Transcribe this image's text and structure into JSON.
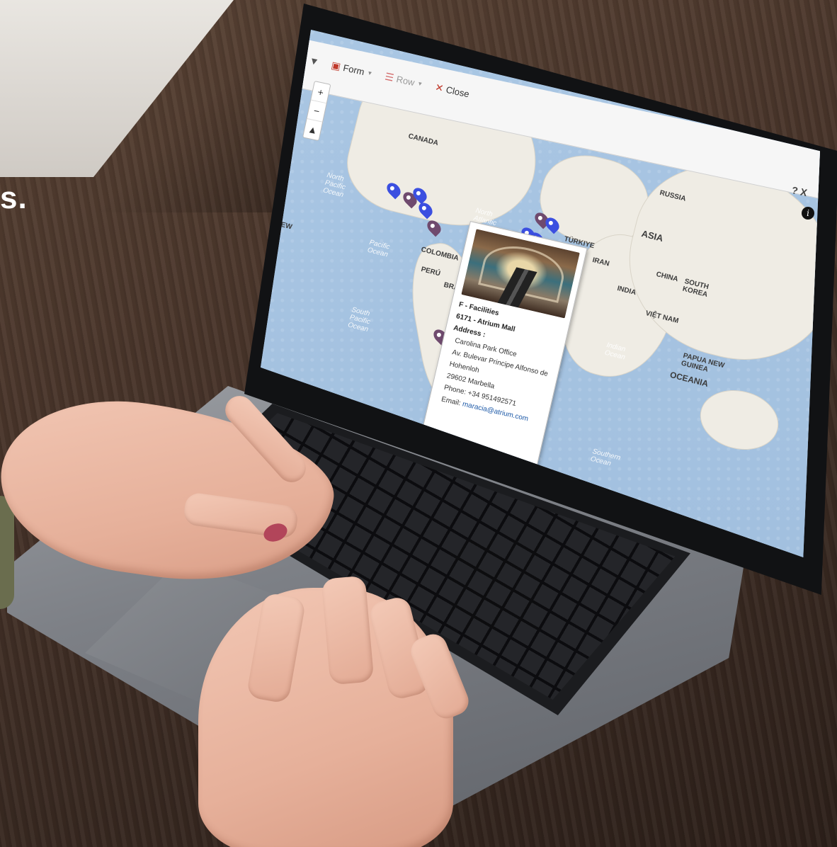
{
  "edge_text": "s.",
  "toolbar": {
    "form_label": "Form",
    "row_label": "Row",
    "close_label": "Close",
    "dropdown_caret": "▼"
  },
  "zoom": {
    "in": "+",
    "out": "−"
  },
  "window_controls": {
    "help": "?",
    "close": "X"
  },
  "map_labels": {
    "canada": "CANADA",
    "russia": "RUSSIA",
    "asia": "ASIA",
    "turkiye": "TÜRKIYE",
    "iran": "IRAN",
    "colombia": "COLOMBIA",
    "peru": "PERÚ",
    "bra": "BRA",
    "india": "INDIA",
    "china": "CHINA",
    "south_korea": "SOUTH KOREA",
    "viet_nam": "VIỆT NAM",
    "png": "PAPUA NEW GUINEA",
    "oceania": "OCEANIA",
    "ew": "EW"
  },
  "ocean_labels": {
    "north_atlantic": "North Atlantic",
    "pacific": "Pacific Ocean",
    "south_pacific": "South Pacific Ocean",
    "north_pacific": "North Pacific Ocean",
    "indian": "Indian Ocean",
    "southern": "Southern Ocean"
  },
  "popup": {
    "category": "F - Facilities",
    "title": "6171 - Atrium Mall",
    "address_label": "Address :",
    "address_line1": "Carolina Park Office",
    "address_line2": "Av. Bulevar Principe Alfonso de",
    "address_line3": "Hohenloh",
    "address_line4": "29602 Marbella",
    "phone": "Phone: +34 951492571",
    "email_label": "Email:",
    "email": "maracia@atrium.com"
  },
  "colors": {
    "pin_blue": "#3b4fe0",
    "pin_purple": "#6f4a6e",
    "water": "#a9c6e3",
    "land": "#efece4",
    "toolbar_icon": "#c0392b"
  }
}
